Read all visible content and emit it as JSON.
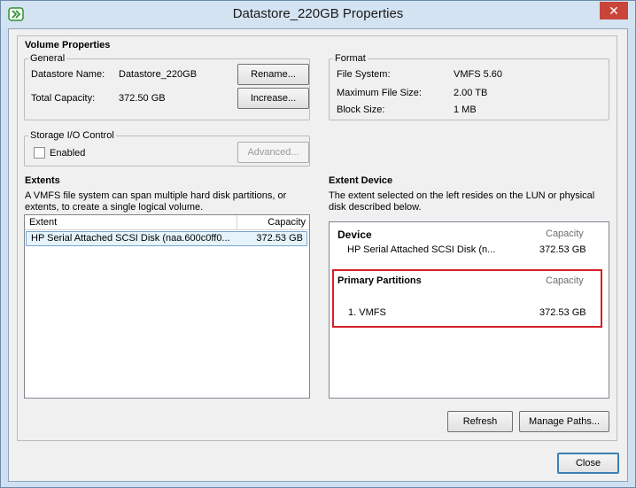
{
  "window": {
    "title": "Datastore_220GB Properties",
    "close_glyph": "✕"
  },
  "volume_properties": {
    "heading": "Volume Properties",
    "general": {
      "legend": "General",
      "datastore_name_label": "Datastore Name:",
      "datastore_name_value": "Datastore_220GB",
      "total_capacity_label": "Total Capacity:",
      "total_capacity_value": "372.50 GB",
      "rename_label": "Rename...",
      "increase_label": "Increase..."
    },
    "format": {
      "legend": "Format",
      "file_system_label": "File System:",
      "file_system_value": "VMFS 5.60",
      "max_file_size_label": "Maximum File Size:",
      "max_file_size_value": "2.00 TB",
      "block_size_label": "Block Size:",
      "block_size_value": "1 MB"
    },
    "sioc": {
      "legend": "Storage I/O Control",
      "enabled_label": "Enabled",
      "enabled": false,
      "advanced_label": "Advanced..."
    }
  },
  "extents": {
    "heading": "Extents",
    "description_line1": "A VMFS file system can span multiple hard disk partitions, or",
    "description_line2": "extents, to create a single logical volume.",
    "columns": {
      "extent": "Extent",
      "capacity": "Capacity"
    },
    "rows": [
      {
        "extent": "HP Serial Attached SCSI Disk (naa.600c0ff0...",
        "capacity": "372.53 GB"
      }
    ]
  },
  "extent_device": {
    "heading": "Extent Device",
    "description_line1": "The extent selected on the left resides on the LUN or physical",
    "description_line2": "disk described below.",
    "device": {
      "label": "Device",
      "capacity_header": "Capacity",
      "name": "HP Serial Attached SCSI Disk (n...",
      "capacity": "372.53 GB"
    },
    "partitions": {
      "label": "Primary Partitions",
      "capacity_header": "Capacity",
      "items": [
        {
          "name": "1. VMFS",
          "capacity": "372.53 GB"
        }
      ]
    },
    "refresh_label": "Refresh",
    "manage_paths_label": "Manage Paths..."
  },
  "footer": {
    "close_label": "Close"
  },
  "colors": {
    "highlight": "#d81e28",
    "close_button": "#c9453a"
  }
}
